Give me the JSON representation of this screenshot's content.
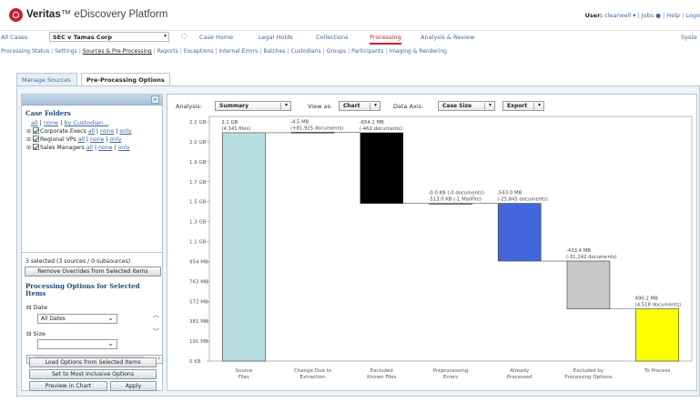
{
  "header": {
    "brand_bold": "Veritas",
    "brand_rest": "™ eDiscovery Platform",
    "user_label": "User:",
    "user_name": "clearwell ▾",
    "jobs": "Jobs",
    "help": "Help",
    "logout": "Logo"
  },
  "nav": {
    "all_cases": "All Cases",
    "case_name": "SEC v Tamas Corp",
    "items": [
      "Case Home",
      "Legal Holds",
      "Collections",
      "Processing",
      "Analysis & Review"
    ],
    "system": "Syste"
  },
  "subnav": {
    "items": [
      "Processing Status",
      "Settings",
      "Sources & Pre-Processing",
      "Reports",
      "Exceptions",
      "Internal Errors",
      "Batches",
      "Custodians",
      "Groups",
      "Participants",
      "Imaging & Rendering"
    ],
    "active_index": 2
  },
  "tabs": [
    "Manage Sources",
    "Pre-Processing Options"
  ],
  "left_panel": {
    "case_folders_title": "Case Folders",
    "top_links": {
      "all": "all",
      "none": "none",
      "by_custodian": "by Custodian..."
    },
    "folders": [
      {
        "name": "Corporate Execs",
        "all": "all",
        "none": "none",
        "only": "only"
      },
      {
        "name": "Regional VPs",
        "all": "all",
        "none": "none",
        "only": "only"
      },
      {
        "name": "Sales Managers",
        "all": "all",
        "none": "none",
        "only": "only"
      }
    ],
    "selected_info": "3 selected (3 sources / 0 subsources)",
    "remove_overrides_btn": "Remove Overrides from Selected Items",
    "options_title": "Processing Options for Selected Items",
    "date_label": "Date",
    "date_value": "All Dates",
    "size_label": "Size",
    "load_options_btn": "Load Options from Selected Items",
    "inclusive_btn": "Set to Most Inclusive Options",
    "preview_btn": "Preview in Chart",
    "apply_btn": "Apply"
  },
  "toolbar": {
    "analysis_label": "Analysis:",
    "analysis_value": "Summary",
    "view_label": "View as:",
    "view_value": "Chart",
    "axis_label": "Data Axis:",
    "axis_value": "Case Size",
    "export_value": "Export"
  },
  "chart_data": {
    "type": "bar",
    "subtype": "waterfall",
    "y_unit": "GB",
    "ylim": [
      0,
      2.2
    ],
    "yticks": [
      "0 KB",
      "191 MB",
      "381 MB",
      "572 MB",
      "763 MB",
      "954 MB",
      "1.1 GB",
      "1.3 GB",
      "1.5 GB",
      "1.7 GB",
      "1.9 GB",
      "2.0 GB",
      "2.2 GB"
    ],
    "categories": [
      "Source\nFiles",
      "Change Due to\nExtraction",
      "Excluded\nKnown Files",
      "Preprocessing\nErrors",
      "Already\nProcessed",
      "Excluded by\nProcessing Options",
      "To Process"
    ],
    "bars": [
      {
        "start": 0,
        "end": 2.1,
        "color": "#b7dfe1",
        "labels": [
          "2.1 GB",
          "(4,141 files)"
        ]
      },
      {
        "start": 2.1,
        "end": 2.1045,
        "color": "#777777",
        "labels": [
          "-4.5 MB",
          "(+81,925 documents)"
        ]
      },
      {
        "start": 2.1,
        "end": 1.45,
        "color": "#000000",
        "labels": [
          "-654.1 MB",
          "(-462 documents)"
        ]
      },
      {
        "start": 1.45,
        "end": 1.45,
        "color": "#888888",
        "labels": [
          "-0.0 KB (-0 documents)",
          "-513.0 KB (-1 MailFile)"
        ]
      },
      {
        "start": 1.45,
        "end": 0.92,
        "color": "#4466dd",
        "labels": [
          "-543.0 MB",
          "(-25,845 documents)"
        ]
      },
      {
        "start": 0.92,
        "end": 0.48,
        "color": "#c8c8c8",
        "labels": [
          "-433.4 MB",
          "(-31,242 documents)"
        ]
      },
      {
        "start": 0,
        "end": 0.48,
        "color": "#ffff00",
        "labels": [
          "490.2 MB",
          "(4,518 documents)"
        ]
      }
    ]
  }
}
